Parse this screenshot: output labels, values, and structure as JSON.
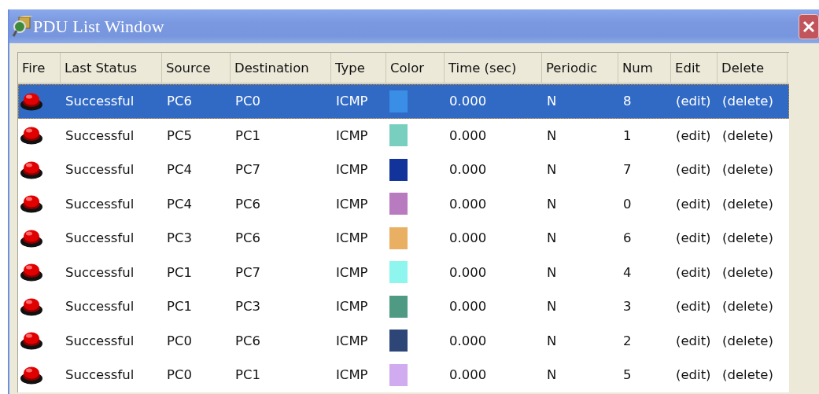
{
  "window": {
    "title": "PDU List Window"
  },
  "table": {
    "columns": [
      "Fire",
      "Last Status",
      "Source",
      "Destination",
      "Type",
      "Color",
      "Time (sec)",
      "Periodic",
      "Num",
      "Edit",
      "Delete"
    ],
    "rows": [
      {
        "selected": true,
        "last_status": "Successful",
        "source": "PC6",
        "destination": "PC0",
        "type": "ICMP",
        "color": "#3a8ee6",
        "time": "0.000",
        "periodic": "N",
        "num": "8",
        "edit": "(edit)",
        "delete": "(delete)"
      },
      {
        "selected": false,
        "last_status": "Successful",
        "source": "PC5",
        "destination": "PC1",
        "type": "ICMP",
        "color": "#78cfc0",
        "time": "0.000",
        "periodic": "N",
        "num": "1",
        "edit": "(edit)",
        "delete": "(delete)"
      },
      {
        "selected": false,
        "last_status": "Successful",
        "source": "PC4",
        "destination": "PC7",
        "type": "ICMP",
        "color": "#12339a",
        "time": "0.000",
        "periodic": "N",
        "num": "7",
        "edit": "(edit)",
        "delete": "(delete)"
      },
      {
        "selected": false,
        "last_status": "Successful",
        "source": "PC4",
        "destination": "PC6",
        "type": "ICMP",
        "color": "#b87bc0",
        "time": "0.000",
        "periodic": "N",
        "num": "0",
        "edit": "(edit)",
        "delete": "(delete)"
      },
      {
        "selected": false,
        "last_status": "Successful",
        "source": "PC3",
        "destination": "PC6",
        "type": "ICMP",
        "color": "#e9b063",
        "time": "0.000",
        "periodic": "N",
        "num": "6",
        "edit": "(edit)",
        "delete": "(delete)"
      },
      {
        "selected": false,
        "last_status": "Successful",
        "source": "PC1",
        "destination": "PC7",
        "type": "ICMP",
        "color": "#8ff5ef",
        "time": "0.000",
        "periodic": "N",
        "num": "4",
        "edit": "(edit)",
        "delete": "(delete)"
      },
      {
        "selected": false,
        "last_status": "Successful",
        "source": "PC1",
        "destination": "PC3",
        "type": "ICMP",
        "color": "#4e9a83",
        "time": "0.000",
        "periodic": "N",
        "num": "3",
        "edit": "(edit)",
        "delete": "(delete)"
      },
      {
        "selected": false,
        "last_status": "Successful",
        "source": "PC0",
        "destination": "PC6",
        "type": "ICMP",
        "color": "#2d4677",
        "time": "0.000",
        "periodic": "N",
        "num": "2",
        "edit": "(edit)",
        "delete": "(delete)"
      },
      {
        "selected": false,
        "last_status": "Successful",
        "source": "PC0",
        "destination": "PC1",
        "type": "ICMP",
        "color": "#d1abef",
        "time": "0.000",
        "periodic": "N",
        "num": "5",
        "edit": "(edit)",
        "delete": "(delete)"
      }
    ]
  }
}
